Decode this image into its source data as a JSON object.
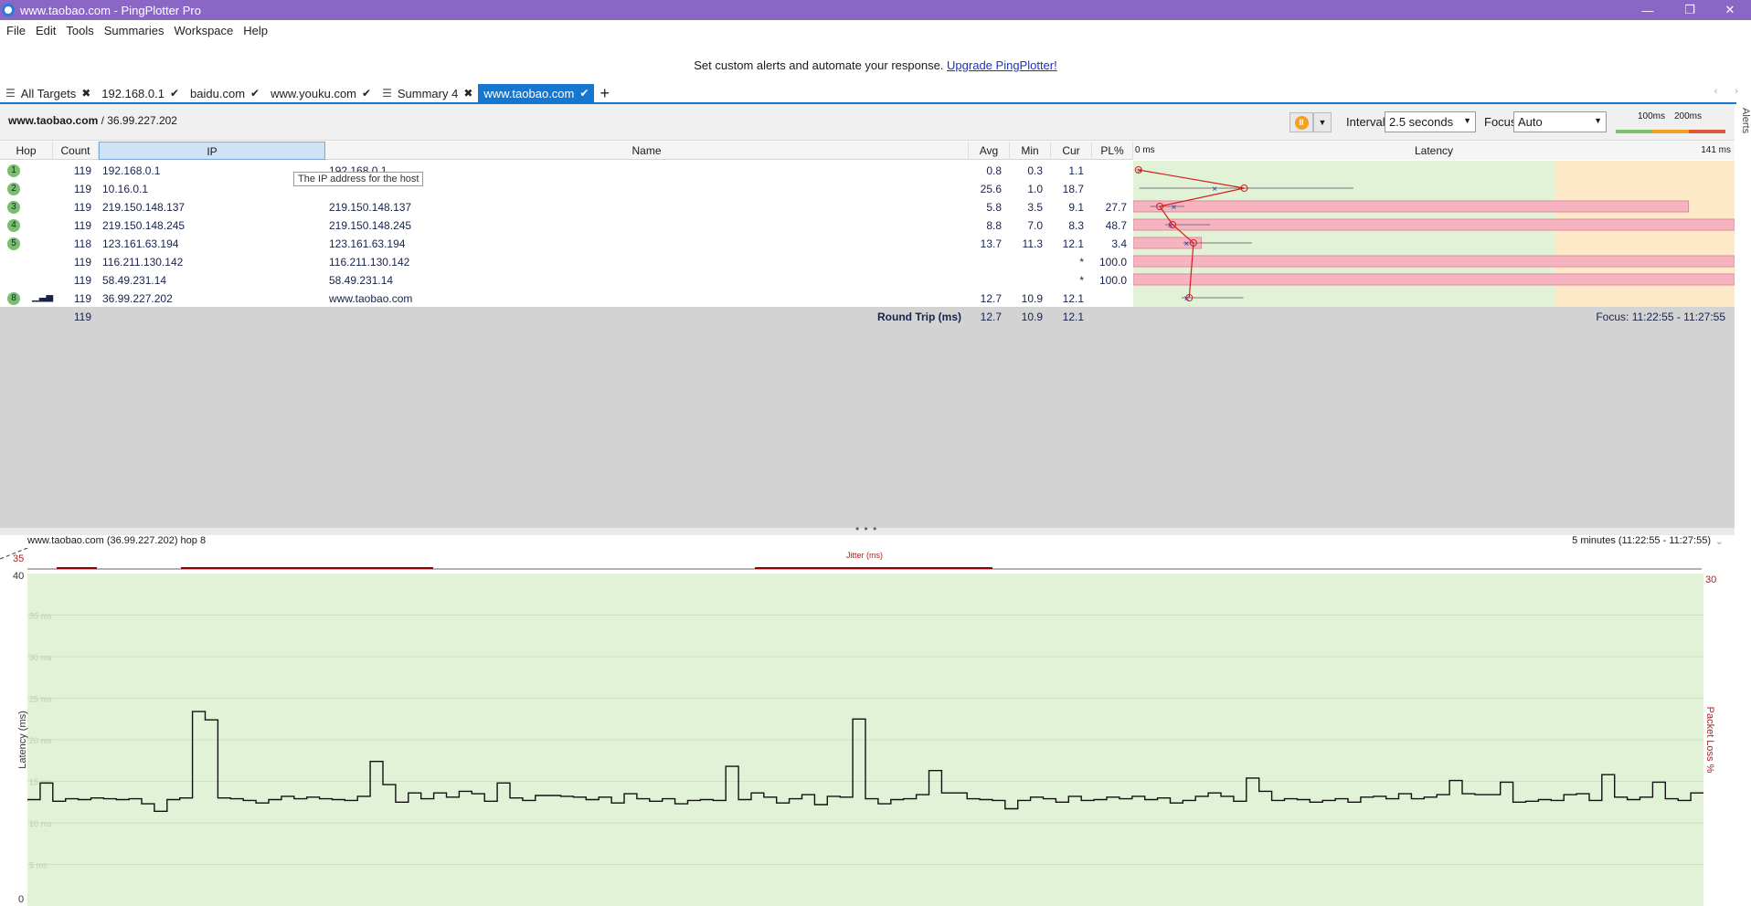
{
  "window": {
    "title": "www.taobao.com - PingPlotter Pro",
    "controls": {
      "minimize": "—",
      "restore": "❐",
      "close": "✕"
    }
  },
  "menu": [
    "File",
    "Edit",
    "Tools",
    "Summaries",
    "Workspace",
    "Help"
  ],
  "promo": {
    "text": "Set custom alerts and automate your response.",
    "link": "Upgrade PingPlotter!"
  },
  "tabs": [
    {
      "label": "All Targets",
      "mark": "✖",
      "icon": "list-icon"
    },
    {
      "label": "192.168.0.1",
      "mark": "✔"
    },
    {
      "label": "baidu.com",
      "mark": "✔"
    },
    {
      "label": "www.youku.com",
      "mark": "✔"
    },
    {
      "label": "Summary 4",
      "mark": "✖",
      "icon": "list-icon"
    },
    {
      "label": "www.taobao.com",
      "mark": "✔",
      "active": true
    }
  ],
  "target": {
    "host": "www.taobao.com",
    "ip": " / 36.99.227.202"
  },
  "toolbar": {
    "interval_label": "Interval",
    "interval_value": "2.5 seconds",
    "focus_label": "Focus",
    "focus_value": "Auto",
    "scale_100": "100ms",
    "scale_200": "200ms",
    "alerts": "Alerts"
  },
  "columns": {
    "hop": "Hop",
    "count": "Count",
    "ip": "IP",
    "name": "Name",
    "avg": "Avg",
    "min": "Min",
    "cur": "Cur",
    "pl": "PL%",
    "latency": "Latency",
    "lat_min": "0 ms",
    "lat_max": "141 ms"
  },
  "tooltip": "The IP address for the host",
  "hops": [
    {
      "hop": "1",
      "count": "119",
      "ip": "192.168.0.1",
      "name": "192.168.0.1",
      "avg": "0.8",
      "min": "0.3",
      "cur": "1.1",
      "pl": "",
      "badge": true
    },
    {
      "hop": "2",
      "count": "119",
      "ip": "10.16.0.1",
      "name": "",
      "avg": "25.6",
      "min": "1.0",
      "cur": "18.7",
      "pl": "",
      "badge": true
    },
    {
      "hop": "3",
      "count": "119",
      "ip": "219.150.148.137",
      "name": "219.150.148.137",
      "avg": "5.8",
      "min": "3.5",
      "cur": "9.1",
      "pl": "27.7",
      "badge": true
    },
    {
      "hop": "4",
      "count": "119",
      "ip": "219.150.148.245",
      "name": "219.150.148.245",
      "avg": "8.8",
      "min": "7.0",
      "cur": "8.3",
      "pl": "48.7",
      "badge": true
    },
    {
      "hop": "5",
      "count": "118",
      "ip": "123.161.63.194",
      "name": "123.161.63.194",
      "avg": "13.7",
      "min": "11.3",
      "cur": "12.1",
      "pl": "3.4",
      "badge": true
    },
    {
      "hop": "",
      "count": "119",
      "ip": "116.211.130.142",
      "name": "116.211.130.142",
      "avg": "",
      "min": "",
      "cur": "*",
      "pl": "100.0",
      "badge": false
    },
    {
      "hop": "",
      "count": "119",
      "ip": "58.49.231.14",
      "name": "58.49.231.14",
      "avg": "",
      "min": "",
      "cur": "*",
      "pl": "100.0",
      "badge": false
    },
    {
      "hop": "8",
      "count": "119",
      "ip": "36.99.227.202",
      "name": "www.taobao.com",
      "avg": "12.7",
      "min": "10.9",
      "cur": "12.1",
      "pl": "",
      "badge": true
    }
  ],
  "roundtrip": {
    "count": "119",
    "label": "Round Trip (ms)",
    "avg": "12.7",
    "min": "10.9",
    "cur": "12.1",
    "focus": "Focus: 11:22:55 - 11:27:55"
  },
  "timeline": {
    "title": "www.taobao.com (36.99.227.202) hop 8",
    "range": "5 minutes (11:22:55 - 11:27:55)",
    "jitter_label": "Jitter (ms)",
    "jitter_max": "35",
    "y_axis_label": "Latency (ms)",
    "right_axis_label": "Packet Loss %",
    "y_top": "40",
    "y_bottom": "0",
    "right_top": "30",
    "grid_labels": [
      "35 ms",
      "30 ms",
      "25 ms",
      "20 ms",
      "15 ms",
      "10 ms",
      "5 ms"
    ]
  },
  "colors": {
    "title_bar": "#8a67c4",
    "active_tab": "#1677d1",
    "good": "#7ac06b",
    "loss": "#f4b6c2",
    "warn_zone": "#fde8c8",
    "ok_zone": "#e2f2d7"
  },
  "chart_data": {
    "type": "line",
    "ylabel": "Latency (ms)",
    "ylim": [
      0,
      40
    ],
    "values": [
      12.8,
      14.8,
      12.6,
      12.9,
      12.8,
      13,
      12.9,
      12.8,
      12.9,
      12.3,
      11.4,
      12.8,
      13,
      23.4,
      22.4,
      13,
      12.9,
      12.7,
      12.4,
      12.8,
      13.2,
      12.9,
      13.1,
      12.9,
      12.8,
      12.7,
      13.2,
      17.4,
      14.6,
      12.5,
      13.6,
      12.9,
      13.6,
      13.1,
      13.8,
      13.5,
      12.6,
      14.8,
      13,
      12.7,
      13.3,
      13.3,
      13.2,
      13.1,
      12.8,
      13.1,
      12.4,
      13.5,
      12.9,
      12.6,
      12.9,
      12.3,
      12.7,
      12.8,
      12.7,
      16.8,
      12.8,
      13.6,
      13.1,
      12.4,
      12.9,
      13.4,
      12.2,
      13.2,
      13.1,
      22.5,
      12.9,
      12.3,
      12.8,
      12.9,
      13.4,
      16.3,
      13.6,
      13.6,
      12.9,
      12.8,
      12.7,
      11.7,
      12.7,
      13.1,
      12.9,
      12.5,
      13.2,
      12.7,
      12.8,
      13.1,
      12.9,
      13.2,
      12.8,
      13,
      12.4,
      12.7,
      13.2,
      13.6,
      13.2,
      12.6,
      15.4,
      13.8,
      12.7,
      12.9,
      12.8,
      12.5,
      12.7,
      12.9,
      12.5,
      13.1,
      13.2,
      12.9,
      13.5,
      12.9,
      13.1,
      13.4,
      15.1,
      13.5,
      13.4,
      13.4,
      14.9,
      12.5,
      12.6,
      12.8,
      12.7,
      13.4,
      13.5,
      12.7,
      15.8,
      13.1,
      12.8,
      13.1,
      14.9,
      12.9,
      12.7,
      13.6
    ]
  }
}
